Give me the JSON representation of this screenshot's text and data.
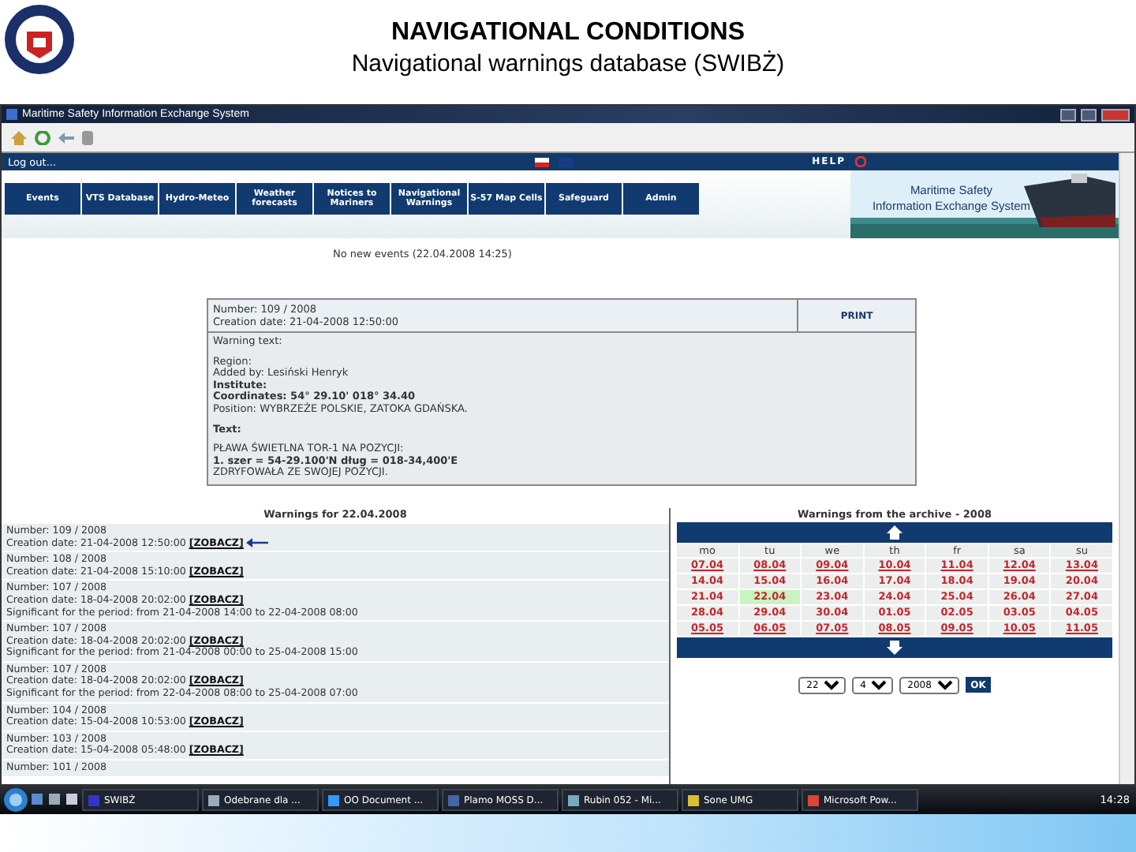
{
  "slide": {
    "title": "NAVIGATIONAL CONDITIONS",
    "subtitle": "Navigational warnings database (SWIBŻ)"
  },
  "window": {
    "title": "Maritime Safety Information Exchange System"
  },
  "nav": {
    "breadcrumb": "Log out...",
    "help": "HELP"
  },
  "menu": [
    "Events",
    "VTS Database",
    "Hydro-Meteo",
    "Weather forecasts",
    "Notices to Mariners",
    "Navigational Warnings",
    "S-57 Map Cells",
    "Safeguard",
    "Admin"
  ],
  "banner": {
    "line_1": "Maritime Safety",
    "line_2": "Information Exchange System"
  },
  "status": "No new events (22.04.2008 14:25)",
  "warning": {
    "number": "Number: 109 / 2008",
    "creation": "Creation date: 21-04-2008 12:50:00",
    "print": "PRINT",
    "blocks": [
      {
        "lines": [
          {
            "text": "Warning text:",
            "bold": false
          }
        ]
      },
      {
        "lines": [
          {
            "text": "Region:",
            "bold": false
          },
          {
            "text": "Added by: Lesiński Henryk",
            "bold": false
          },
          {
            "text": "Institute:",
            "bold": true
          },
          {
            "text": "Coordinates:    54° 29.10'   018° 34.40",
            "bold": true
          },
          {
            "text": "Position: WYBRZEŻE POLSKIE, ZATOKA GDAŃSKA.",
            "bold": false
          }
        ]
      },
      {
        "lines": [
          {
            "text": "Text:",
            "bold": true
          }
        ]
      },
      {
        "lines": [
          {
            "text": "PŁAWA ŚWIETLNA TOR-1 NA POZYCJI:",
            "bold": false
          },
          {
            "text": "1. szer = 54-29.100'N dług = 018-34,400'E",
            "bold": true
          },
          {
            "text": "ZDRYFOWAŁA ZE SWOJEJ POZYCJI.",
            "bold": false
          }
        ]
      }
    ]
  },
  "list": {
    "title": "Warnings for 22.04.2008",
    "rows": [
      {
        "number": "Number: 109 / 2008",
        "creation": "Creation date: 21-04-2008 12:50:00",
        "link": "[ZOBACZ]",
        "marked": true
      },
      {
        "number": "Number: 108 / 2008",
        "creation": "Creation date: 21-04-2008 15:10:00",
        "link": "[ZOBACZ]",
        "marked": false
      },
      {
        "number": "Number: 107 / 2008",
        "creation": "Creation date: 18-04-2008 20:02:00",
        "link": "[ZOBACZ]",
        "period": "Significant for the period: from 21-04-2008 14:00 to 22-04-2008 08:00",
        "marked": false
      },
      {
        "number": "Number: 107 / 2008",
        "creation": "Creation date: 18-04-2008 20:02:00",
        "link": "[ZOBACZ]",
        "period": "Significant for the period: from 21-04-2008 00:00 to 25-04-2008 15:00",
        "marked": false
      },
      {
        "number": "Number: 107 / 2008",
        "creation": "Creation date: 18-04-2008 20:02:00",
        "link": "[ZOBACZ]",
        "period": "Significant for the period: from 22-04-2008 08:00 to 25-04-2008 07:00",
        "marked": false
      },
      {
        "number": "Number: 104 / 2008",
        "creation": "Creation date: 15-04-2008 10:53:00",
        "link": "[ZOBACZ]",
        "marked": false
      },
      {
        "number": "Number: 103 / 2008",
        "creation": "Creation date: 15-04-2008 05:48:00",
        "link": "[ZOBACZ]",
        "marked": false
      },
      {
        "number": "Number: 101 / 2008",
        "marked": false
      }
    ]
  },
  "calendar": {
    "title": "Warnings from the archive - 2008",
    "days": [
      "mo",
      "tu",
      "we",
      "th",
      "fr",
      "sa",
      "su"
    ],
    "weeks": [
      [
        {
          "label": "07.04",
          "link": true,
          "today": false
        },
        {
          "label": "08.04",
          "link": true,
          "today": false
        },
        {
          "label": "09.04",
          "link": true,
          "today": false
        },
        {
          "label": "10.04",
          "link": true,
          "today": false
        },
        {
          "label": "11.04",
          "link": true,
          "today": false
        },
        {
          "label": "12.04",
          "link": true,
          "today": false
        },
        {
          "label": "13.04",
          "link": true,
          "today": false
        }
      ],
      [
        {
          "label": "14.04",
          "link": false,
          "today": false
        },
        {
          "label": "15.04",
          "link": false,
          "today": false
        },
        {
          "label": "16.04",
          "link": false,
          "today": false
        },
        {
          "label": "17.04",
          "link": false,
          "today": false
        },
        {
          "label": "18.04",
          "link": false,
          "today": false
        },
        {
          "label": "19.04",
          "link": false,
          "today": false
        },
        {
          "label": "20.04",
          "link": false,
          "today": false
        }
      ],
      [
        {
          "label": "21.04",
          "link": false,
          "today": false
        },
        {
          "label": "22.04",
          "link": false,
          "today": true
        },
        {
          "label": "23.04",
          "link": false,
          "today": false
        },
        {
          "label": "24.04",
          "link": false,
          "today": false
        },
        {
          "label": "25.04",
          "link": false,
          "today": false
        },
        {
          "label": "26.04",
          "link": false,
          "today": false
        },
        {
          "label": "27.04",
          "link": false,
          "today": false
        }
      ],
      [
        {
          "label": "28.04",
          "link": false,
          "today": false
        },
        {
          "label": "29.04",
          "link": false,
          "today": false
        },
        {
          "label": "30.04",
          "link": false,
          "today": false
        },
        {
          "label": "01.05",
          "link": false,
          "today": false
        },
        {
          "label": "02.05",
          "link": false,
          "today": false
        },
        {
          "label": "03.05",
          "link": false,
          "today": false
        },
        {
          "label": "04.05",
          "link": false,
          "today": false
        }
      ],
      [
        {
          "label": "05.05",
          "link": true,
          "today": false
        },
        {
          "label": "06.05",
          "link": true,
          "today": false
        },
        {
          "label": "07.05",
          "link": true,
          "today": false
        },
        {
          "label": "08.05",
          "link": true,
          "today": false
        },
        {
          "label": "09.05",
          "link": true,
          "today": false
        },
        {
          "label": "10.05",
          "link": true,
          "today": false
        },
        {
          "label": "11.05",
          "link": true,
          "today": false
        }
      ]
    ],
    "day": "22",
    "month": "4",
    "year": "2008",
    "ok": "OK"
  },
  "taskbar": {
    "items": [
      "SWIBŻ",
      "Odebrane dla ...",
      "OO Document ...",
      "Plamo MOSS D...",
      "Rubin 052 - Mi...",
      "Sone UMG",
      "Microsoft Pow..."
    ],
    "clock": "14:28"
  }
}
